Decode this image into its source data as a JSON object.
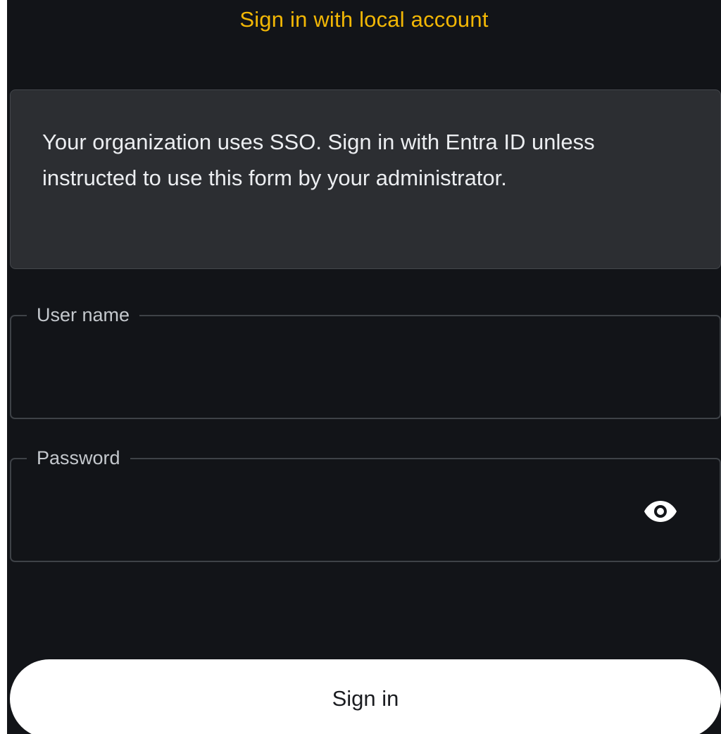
{
  "header": {
    "title": "Sign in with local account"
  },
  "notice": {
    "text": "Your organization uses SSO. Sign in with Entra ID unless instructed to use this form by your administrator."
  },
  "form": {
    "username": {
      "label": "User name",
      "value": ""
    },
    "password": {
      "label": "Password",
      "value": "",
      "toggle_icon": "eye-icon"
    },
    "submit_label": "Sign in"
  },
  "colors": {
    "background": "#121418",
    "accent_title": "#f2b705",
    "notice_background": "#2c2e32",
    "field_border": "#3e4247",
    "button_background": "#ffffff"
  }
}
